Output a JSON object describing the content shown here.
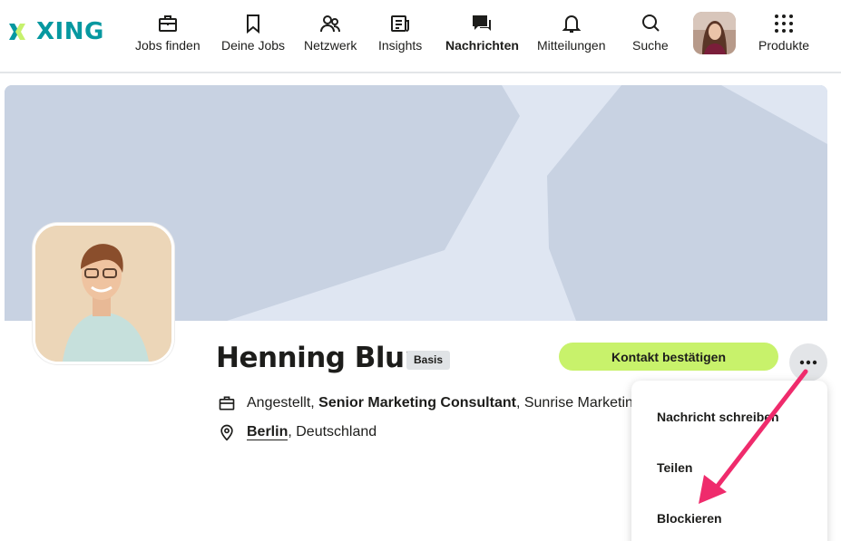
{
  "brand": {
    "name": "XING",
    "accent": "#0698a0",
    "logo_green": "#c6f16d"
  },
  "nav": {
    "items": [
      {
        "label": "Jobs finden",
        "icon": "briefcase-icon"
      },
      {
        "label": "Deine Jobs",
        "icon": "bookmark-icon"
      },
      {
        "label": "Netzwerk",
        "icon": "people-icon"
      },
      {
        "label": "Insights",
        "icon": "insights-icon"
      },
      {
        "label": "Nachrichten",
        "icon": "chat-icon",
        "active": true
      },
      {
        "label": "Mitteilungen",
        "icon": "bell-icon"
      },
      {
        "label": "Suche",
        "icon": "search-icon"
      },
      {
        "label": "Produkte",
        "icon": "grid-icon"
      }
    ]
  },
  "profile": {
    "name": "Henning Blum",
    "membership_badge": "Basis",
    "employment_status": "Angestellt",
    "position": "Senior Marketing Consultant",
    "company": "Sunrise Marketing",
    "city": "Berlin",
    "country": "Deutschland"
  },
  "actions": {
    "primary_label": "Kontakt bestätigen",
    "primary_color": "#c8f26b",
    "more_icon": "more-horizontal-icon"
  },
  "menu": {
    "items": [
      "Nachricht schreiben",
      "Teilen",
      "Blockieren"
    ]
  },
  "annotation": {
    "arrow_color": "#ef2b6c"
  }
}
